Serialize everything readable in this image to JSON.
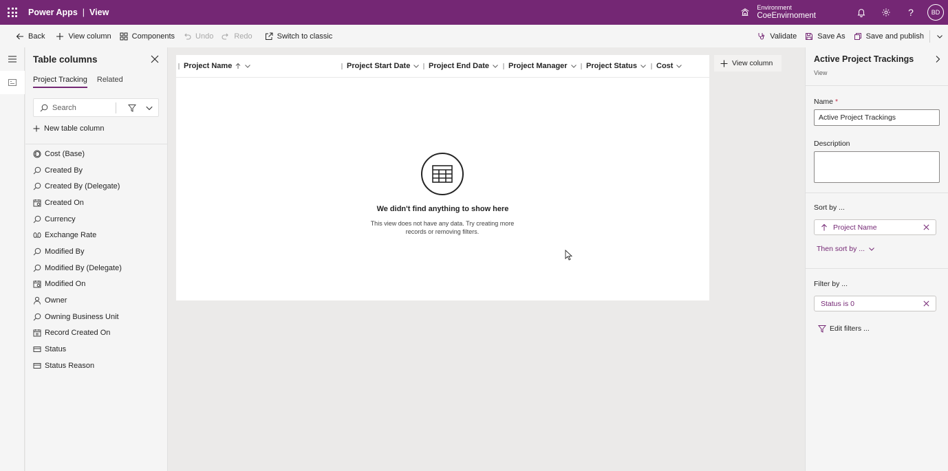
{
  "topbar": {
    "app_name": "Power Apps",
    "separator": "|",
    "page": "View",
    "environment_label": "Environment",
    "environment_name": "CoeEnvirnoment",
    "help": "?",
    "avatar_initials": "BD"
  },
  "commands": {
    "back": "Back",
    "view_column": "View column",
    "components": "Components",
    "undo": "Undo",
    "redo": "Redo",
    "switch_classic": "Switch to classic",
    "validate": "Validate",
    "save_as": "Save As",
    "save_publish": "Save and publish"
  },
  "columns_panel": {
    "title": "Table columns",
    "tabs": [
      {
        "label": "Project Tracking",
        "active": true
      },
      {
        "label": "Related",
        "active": false
      }
    ],
    "search_placeholder": "Search",
    "new_column": "New table column",
    "items": [
      {
        "label": "Cost (Base)",
        "icon": "currency-icon"
      },
      {
        "label": "Created By",
        "icon": "lookup-icon"
      },
      {
        "label": "Created By (Delegate)",
        "icon": "lookup-icon"
      },
      {
        "label": "Created On",
        "icon": "calendar-icon"
      },
      {
        "label": "Currency",
        "icon": "lookup-icon"
      },
      {
        "label": "Exchange Rate",
        "icon": "decimal-icon"
      },
      {
        "label": "Modified By",
        "icon": "lookup-icon"
      },
      {
        "label": "Modified By (Delegate)",
        "icon": "lookup-icon"
      },
      {
        "label": "Modified On",
        "icon": "calendar-icon"
      },
      {
        "label": "Owner",
        "icon": "person-icon"
      },
      {
        "label": "Owning Business Unit",
        "icon": "lookup-icon"
      },
      {
        "label": "Record Created On",
        "icon": "date-icon"
      },
      {
        "label": "Status",
        "icon": "choice-icon"
      },
      {
        "label": "Status Reason",
        "icon": "choice-icon"
      }
    ]
  },
  "grid": {
    "columns": [
      "Project Name",
      "Project Start Date",
      "Project End Date",
      "Project Manager",
      "Project Status",
      "Cost"
    ],
    "empty_title": "We didn't find anything to show here",
    "empty_message": "This view does not have any data. Try creating more records or removing filters.",
    "add_column": "View column"
  },
  "properties": {
    "title": "Active Project Trackings",
    "subtitle": "View",
    "name_label": "Name",
    "required_mark": "*",
    "name_value": "Active Project Trackings",
    "description_label": "Description",
    "sort_label": "Sort by ...",
    "sort_value": "Project Name",
    "then_sort": "Then sort by ...",
    "filter_label": "Filter by ...",
    "filter_value": "Status is 0",
    "edit_filters": "Edit filters ..."
  },
  "colors": {
    "brand": "#742774",
    "canvas": "#ebeae9",
    "panel": "#f5f5f5"
  }
}
